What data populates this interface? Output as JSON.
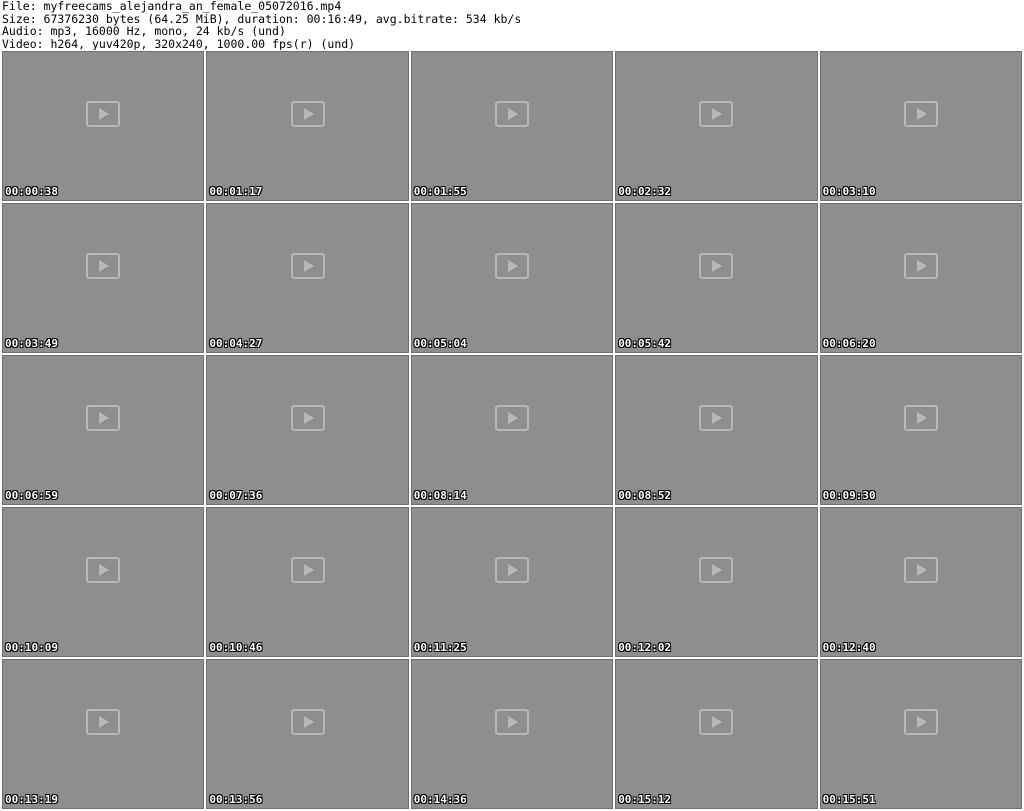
{
  "header": {
    "file_line": "File: myfreecams_alejandra_an_female_05072016.mp4",
    "size_line": "Size: 67376230 bytes (64.25 MiB), duration: 00:16:49, avg.bitrate: 534 kb/s",
    "audio_line": "Audio: mp3, 16000 Hz, mono, 24 kb/s (und)",
    "video_line": "Video: h264, yuv420p, 320x240, 1000.00 fps(r) (und)"
  },
  "thumbnails": [
    {
      "timestamp": "00:00:38"
    },
    {
      "timestamp": "00:01:17"
    },
    {
      "timestamp": "00:01:55"
    },
    {
      "timestamp": "00:02:32"
    },
    {
      "timestamp": "00:03:10"
    },
    {
      "timestamp": "00:03:49"
    },
    {
      "timestamp": "00:04:27"
    },
    {
      "timestamp": "00:05:04"
    },
    {
      "timestamp": "00:05:42"
    },
    {
      "timestamp": "00:06:20"
    },
    {
      "timestamp": "00:06:59"
    },
    {
      "timestamp": "00:07:36"
    },
    {
      "timestamp": "00:08:14"
    },
    {
      "timestamp": "00:08:52"
    },
    {
      "timestamp": "00:09:30"
    },
    {
      "timestamp": "00:10:09"
    },
    {
      "timestamp": "00:10:46"
    },
    {
      "timestamp": "00:11:25"
    },
    {
      "timestamp": "00:12:02"
    },
    {
      "timestamp": "00:12:40"
    },
    {
      "timestamp": "00:13:19"
    },
    {
      "timestamp": "00:13:56"
    },
    {
      "timestamp": "00:14:36"
    },
    {
      "timestamp": "00:15:12"
    },
    {
      "timestamp": "00:15:51"
    }
  ]
}
